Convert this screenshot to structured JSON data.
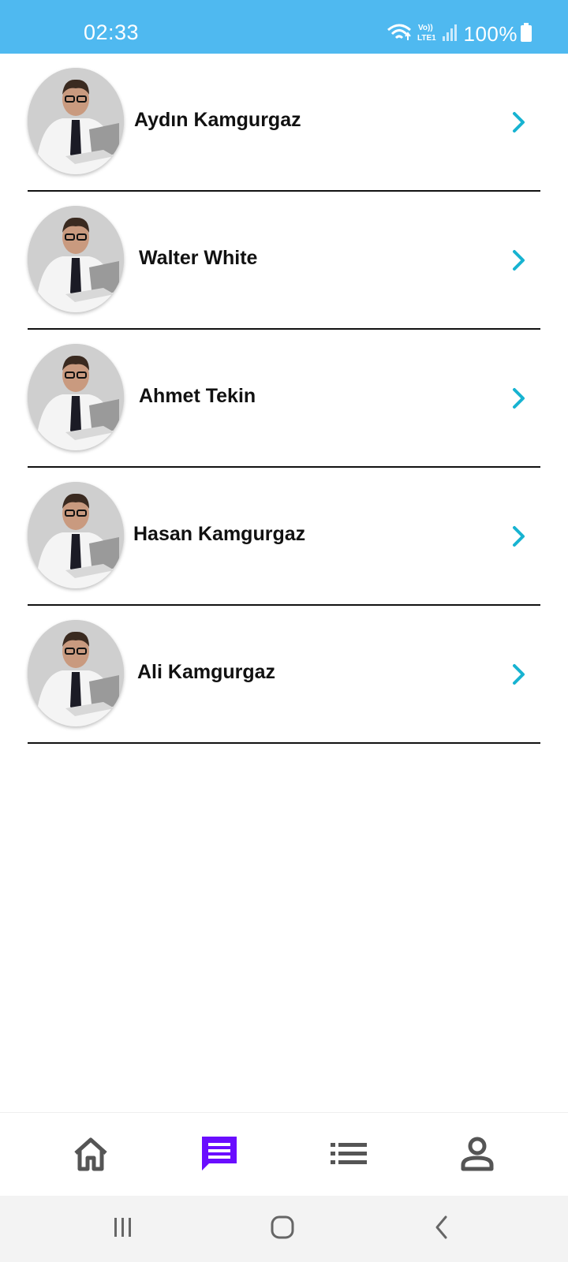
{
  "status_bar": {
    "time": "02:33",
    "network_label": "Vo)) LTE1",
    "battery_text": "100%",
    "background_color": "#4fb9f0"
  },
  "contacts": [
    {
      "name": "Aydın Kamgurgaz",
      "avatar_icon": "person-photo"
    },
    {
      "name": "Walter White",
      "avatar_icon": "person-photo"
    },
    {
      "name": "Ahmet Tekin",
      "avatar_icon": "person-photo"
    },
    {
      "name": "Hasan Kamgurgaz",
      "avatar_icon": "person-photo"
    },
    {
      "name": "Ali Kamgurgaz",
      "avatar_icon": "person-photo"
    }
  ],
  "accent_color": "#17b3d1",
  "bottom_nav": {
    "items": [
      {
        "icon": "home-icon",
        "active": false
      },
      {
        "icon": "chat-icon",
        "active": true
      },
      {
        "icon": "list-icon",
        "active": false
      },
      {
        "icon": "profile-icon",
        "active": false
      }
    ],
    "active_color": "#6a0dff",
    "inactive_color": "#555555"
  },
  "system_nav": {
    "items": [
      "recents-icon",
      "home-circle-icon",
      "back-icon"
    ]
  }
}
